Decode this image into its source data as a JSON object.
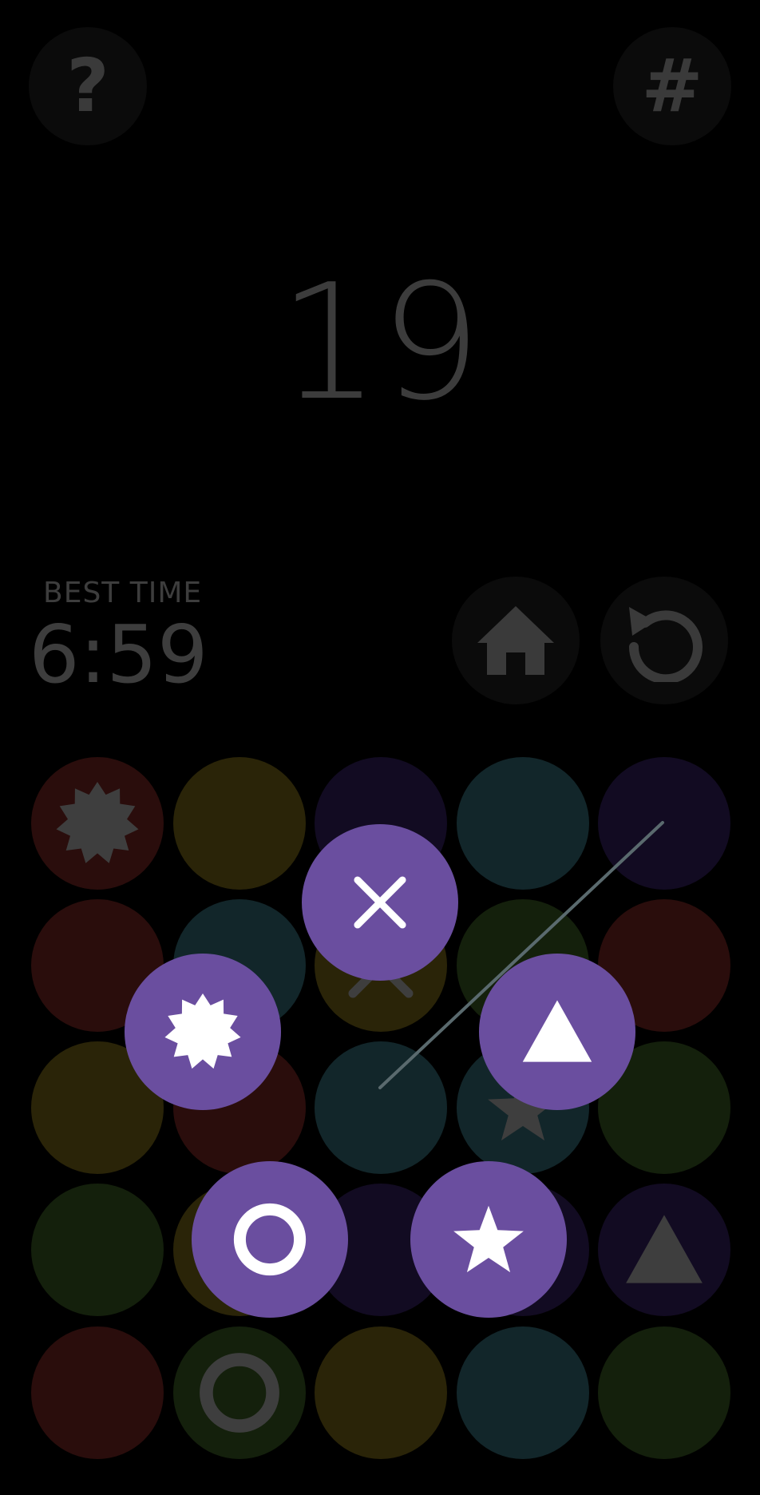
{
  "header": {
    "help_label": "?",
    "grid_label": "#"
  },
  "counter": {
    "value": "19"
  },
  "best_time": {
    "label": "BEST TIME",
    "value": "6:59"
  },
  "colors": {
    "red": "#2a0d0c",
    "yellow": "#2a2408",
    "indigo": "#120b22",
    "teal": "#12262a",
    "green": "#14200c",
    "dim_icon": "#3e3e3e",
    "accent_purple": "#6a4e9f"
  },
  "board": {
    "rows": [
      [
        {
          "color": "red",
          "icon": "sun-burst-icon"
        },
        {
          "color": "yellow",
          "icon": ""
        },
        {
          "color": "indigo",
          "icon": ""
        },
        {
          "color": "teal",
          "icon": ""
        },
        {
          "color": "indigo",
          "icon": ""
        }
      ],
      [
        {
          "color": "red",
          "icon": ""
        },
        {
          "color": "teal",
          "icon": ""
        },
        {
          "color": "yellow",
          "icon": "cross-icon"
        },
        {
          "color": "green",
          "icon": ""
        },
        {
          "color": "red",
          "icon": ""
        }
      ],
      [
        {
          "color": "yellow",
          "icon": ""
        },
        {
          "color": "red",
          "icon": ""
        },
        {
          "color": "teal",
          "icon": ""
        },
        {
          "color": "teal",
          "icon": "star-icon"
        },
        {
          "color": "green",
          "icon": ""
        }
      ],
      [
        {
          "color": "green",
          "icon": ""
        },
        {
          "color": "yellow",
          "icon": ""
        },
        {
          "color": "indigo",
          "icon": ""
        },
        {
          "color": "indigo",
          "icon": ""
        },
        {
          "color": "indigo",
          "icon": "triangle-icon"
        }
      ],
      [
        {
          "color": "red",
          "icon": ""
        },
        {
          "color": "green",
          "icon": "ring-icon"
        },
        {
          "color": "yellow",
          "icon": ""
        },
        {
          "color": "teal",
          "icon": ""
        },
        {
          "color": "green",
          "icon": ""
        }
      ]
    ]
  },
  "symbol_picker": {
    "options": [
      "cross-icon",
      "sun-burst-icon",
      "triangle-icon",
      "ring-icon",
      "star-icon"
    ]
  }
}
